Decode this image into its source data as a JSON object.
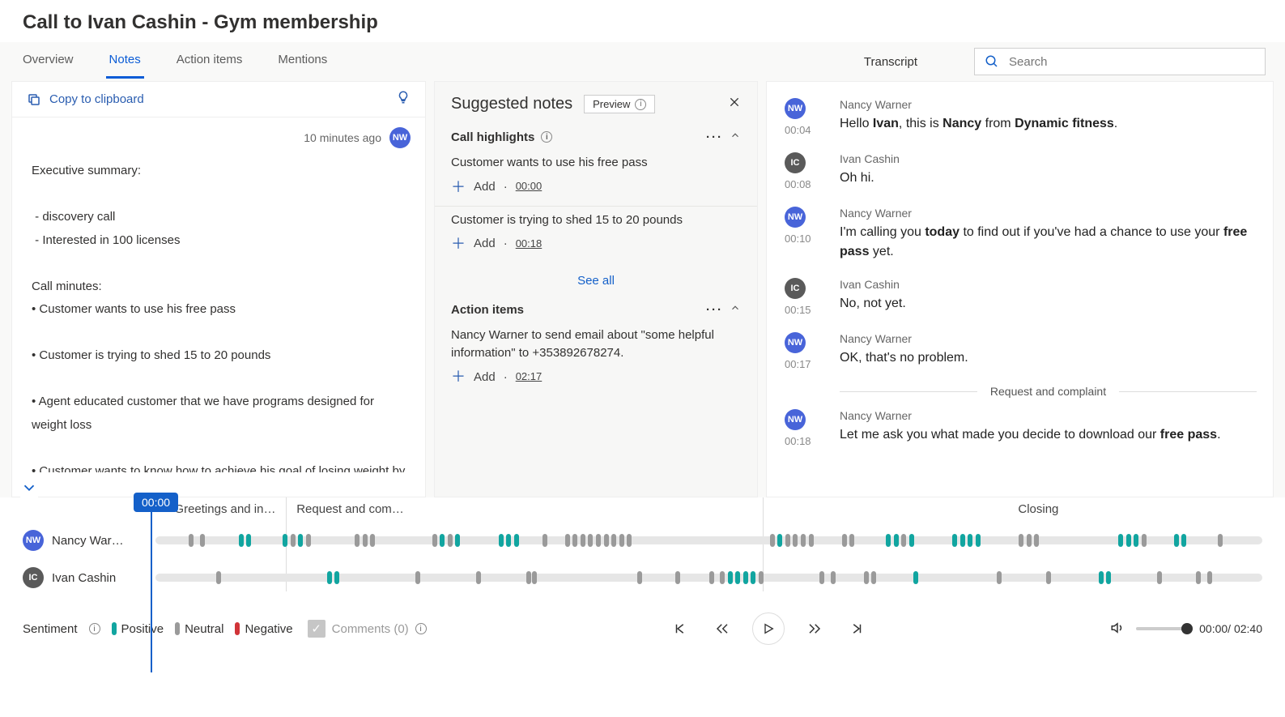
{
  "page_title": "Call to Ivan Cashin - Gym membership",
  "tabs": [
    "Overview",
    "Notes",
    "Action items",
    "Mentions"
  ],
  "active_tab": 1,
  "transcript_label": "Transcript",
  "search_placeholder": "Search",
  "notes_panel": {
    "copy_label": "Copy to clipboard",
    "timestamp": "10 minutes ago",
    "author_initials": "NW",
    "body": "Executive summary:\n\n - discovery call\n - Interested in 100 licenses\n\nCall minutes:\n• Customer wants to use his free pass\n\n• Customer is trying to shed 15 to 20 pounds\n\n• Agent educated customer that we have programs designed for weight loss\n\n• Customer wants to know how to achieve his goal of losing weight by the summer\n"
  },
  "suggested": {
    "title": "Suggested notes",
    "preview_label": "Preview",
    "highlights_header": "Call highlights",
    "action_items_header": "Action items",
    "add_label": "Add",
    "see_all_label": "See all",
    "highlights": [
      {
        "text": "Customer wants to use his free pass",
        "ts": "00:00"
      },
      {
        "text": "Customer is trying to shed 15 to 20 pounds",
        "ts": "00:18"
      }
    ],
    "action_items": [
      {
        "text": "Nancy Warner to send email about \"some helpful information\" to +353892678274.",
        "ts": "02:17"
      }
    ]
  },
  "transcript": [
    {
      "initials": "NW",
      "avatar": "nw",
      "name": "Nancy Warner",
      "ts": "00:04",
      "html": "Hello <b>Ivan</b>, this is <b>Nancy</b> from <b>Dynamic fitness</b>."
    },
    {
      "initials": "IC",
      "avatar": "ic",
      "name": "Ivan Cashin",
      "ts": "00:08",
      "html": "Oh hi."
    },
    {
      "initials": "NW",
      "avatar": "nw",
      "name": "Nancy Warner",
      "ts": "00:10",
      "html": "I'm calling you <b>today</b> to find out if you've had a chance to use your <b>free pass</b> yet."
    },
    {
      "initials": "IC",
      "avatar": "ic",
      "name": "Ivan Cashin",
      "ts": "00:15",
      "html": "No, not yet."
    },
    {
      "initials": "NW",
      "avatar": "nw",
      "name": "Nancy Warner",
      "ts": "00:17",
      "html": "OK, that's no problem."
    },
    {
      "divider": "Request and complaint"
    },
    {
      "initials": "NW",
      "avatar": "nw",
      "name": "Nancy Warner",
      "ts": "00:18",
      "html": "Let me ask you what made you decide to download our <b>free pass</b>."
    }
  ],
  "timeline": {
    "playhead_label": "00:00",
    "segments": [
      {
        "label": "Greetings and in…",
        "left_pct": 2
      },
      {
        "label": "Request and com…",
        "left_pct": 13
      },
      {
        "label": "Closing",
        "left_pct": 78
      }
    ],
    "separators_pct": [
      12,
      55
    ],
    "speakers": [
      {
        "initials": "NW",
        "avatar": "nw",
        "name": "Nancy War…",
        "ticks": [
          {
            "p": 3,
            "t": "neu"
          },
          {
            "p": 4,
            "t": "neu"
          },
          {
            "p": 7.5,
            "t": "pos"
          },
          {
            "p": 8.2,
            "t": "pos"
          },
          {
            "p": 11.5,
            "t": "pos"
          },
          {
            "p": 12.2,
            "t": "neu"
          },
          {
            "p": 12.9,
            "t": "pos"
          },
          {
            "p": 13.6,
            "t": "neu"
          },
          {
            "p": 18,
            "t": "neu"
          },
          {
            "p": 18.7,
            "t": "neu"
          },
          {
            "p": 19.4,
            "t": "neu"
          },
          {
            "p": 25,
            "t": "neu"
          },
          {
            "p": 25.7,
            "t": "pos"
          },
          {
            "p": 26.4,
            "t": "neu"
          },
          {
            "p": 27.1,
            "t": "pos"
          },
          {
            "p": 31,
            "t": "pos"
          },
          {
            "p": 31.7,
            "t": "pos"
          },
          {
            "p": 32.4,
            "t": "pos"
          },
          {
            "p": 35,
            "t": "neu"
          },
          {
            "p": 37,
            "t": "neu"
          },
          {
            "p": 37.7,
            "t": "neu"
          },
          {
            "p": 38.4,
            "t": "neu"
          },
          {
            "p": 39.1,
            "t": "neu"
          },
          {
            "p": 39.8,
            "t": "neu"
          },
          {
            "p": 40.5,
            "t": "neu"
          },
          {
            "p": 41.2,
            "t": "neu"
          },
          {
            "p": 41.9,
            "t": "neu"
          },
          {
            "p": 42.6,
            "t": "neu"
          },
          {
            "p": 55.5,
            "t": "neu"
          },
          {
            "p": 56.2,
            "t": "pos"
          },
          {
            "p": 56.9,
            "t": "neu"
          },
          {
            "p": 57.6,
            "t": "neu"
          },
          {
            "p": 58.3,
            "t": "neu"
          },
          {
            "p": 59,
            "t": "neu"
          },
          {
            "p": 62,
            "t": "neu"
          },
          {
            "p": 62.7,
            "t": "neu"
          },
          {
            "p": 66,
            "t": "pos"
          },
          {
            "p": 66.7,
            "t": "pos"
          },
          {
            "p": 67.4,
            "t": "neu"
          },
          {
            "p": 68.1,
            "t": "pos"
          },
          {
            "p": 72,
            "t": "pos"
          },
          {
            "p": 72.7,
            "t": "pos"
          },
          {
            "p": 73.4,
            "t": "pos"
          },
          {
            "p": 74.1,
            "t": "pos"
          },
          {
            "p": 78,
            "t": "neu"
          },
          {
            "p": 78.7,
            "t": "neu"
          },
          {
            "p": 79.4,
            "t": "neu"
          },
          {
            "p": 87,
            "t": "pos"
          },
          {
            "p": 87.7,
            "t": "pos"
          },
          {
            "p": 88.4,
            "t": "pos"
          },
          {
            "p": 89.1,
            "t": "neu"
          },
          {
            "p": 92,
            "t": "pos"
          },
          {
            "p": 92.7,
            "t": "pos"
          },
          {
            "p": 96,
            "t": "neu"
          }
        ]
      },
      {
        "initials": "IC",
        "avatar": "ic",
        "name": "Ivan Cashin",
        "ticks": [
          {
            "p": 5.5,
            "t": "neu"
          },
          {
            "p": 15.5,
            "t": "pos"
          },
          {
            "p": 16.2,
            "t": "pos"
          },
          {
            "p": 23.5,
            "t": "neu"
          },
          {
            "p": 29,
            "t": "neu"
          },
          {
            "p": 33.5,
            "t": "neu"
          },
          {
            "p": 34,
            "t": "neu"
          },
          {
            "p": 43.5,
            "t": "neu"
          },
          {
            "p": 47,
            "t": "neu"
          },
          {
            "p": 50,
            "t": "neu"
          },
          {
            "p": 51,
            "t": "neu"
          },
          {
            "p": 51.7,
            "t": "pos"
          },
          {
            "p": 52.4,
            "t": "pos"
          },
          {
            "p": 53.1,
            "t": "pos"
          },
          {
            "p": 53.8,
            "t": "pos"
          },
          {
            "p": 54.5,
            "t": "neu"
          },
          {
            "p": 60,
            "t": "neu"
          },
          {
            "p": 61,
            "t": "neu"
          },
          {
            "p": 64,
            "t": "neu"
          },
          {
            "p": 64.7,
            "t": "neu"
          },
          {
            "p": 68.5,
            "t": "pos"
          },
          {
            "p": 76,
            "t": "neu"
          },
          {
            "p": 80.5,
            "t": "neu"
          },
          {
            "p": 85.2,
            "t": "pos"
          },
          {
            "p": 85.9,
            "t": "pos"
          },
          {
            "p": 90.5,
            "t": "neu"
          },
          {
            "p": 94,
            "t": "neu"
          },
          {
            "p": 95,
            "t": "neu"
          }
        ]
      }
    ]
  },
  "footer": {
    "sentiment_label": "Sentiment",
    "legend": {
      "positive": "Positive",
      "neutral": "Neutral",
      "negative": "Negative"
    },
    "comments_label": "Comments (0)",
    "current_time": "00:00",
    "total_time": "02:40"
  }
}
